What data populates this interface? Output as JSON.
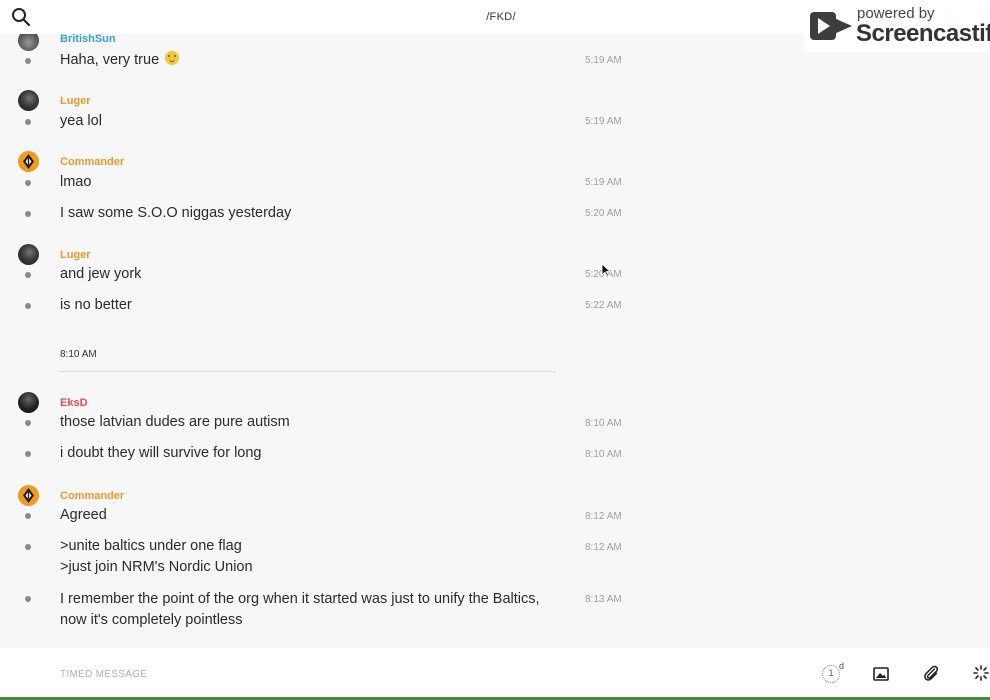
{
  "header": {
    "channel_title": "/FKD/"
  },
  "watermark": {
    "powered_by": "powered by",
    "brand": "Screencastify"
  },
  "messages": [
    {
      "author": "BritishSun",
      "text": "Haha, very true",
      "time": "5:19 AM"
    },
    {
      "author": "Luger",
      "text": "yea lol",
      "time": "5:19 AM"
    },
    {
      "author": "Commander",
      "text": "lmao",
      "time": "5:19 AM"
    },
    {
      "author": "",
      "text": "I saw some S.O.O niggas yesterday",
      "time": "5:20 AM"
    },
    {
      "author": "Luger",
      "text": "and jew york",
      "time": "5:20 AM"
    },
    {
      "author": "",
      "text": "is no better",
      "time": "5:22 AM"
    },
    {
      "author": "EksD",
      "text": "those latvian dudes are pure autism",
      "time": "8:10 AM"
    },
    {
      "author": "",
      "text": "i doubt they will survive for long",
      "time": "8:10 AM"
    },
    {
      "author": "Commander",
      "text": "Agreed",
      "time": "8:12 AM"
    },
    {
      "author": "",
      "text": ">unite baltics under one flag",
      "text2": ">just join NRM's Nordic Union",
      "time": "8:12 AM"
    },
    {
      "author": "",
      "text": "I remember the point of the org when it started was just to unify the Baltics,",
      "text2": "now it's completely pointless",
      "time": "8:13 AM"
    }
  ],
  "divider": {
    "label": "8:10 AM"
  },
  "composer": {
    "placeholder": "TIMED MESSAGE",
    "timer_value": "1",
    "timer_unit": "d"
  },
  "icons": {
    "search": "search-icon",
    "phone": "phone-icon",
    "info": "info-icon",
    "image": "image-icon",
    "attach": "paperclip-icon",
    "more": "sparkle-icon"
  },
  "colors": {
    "author_orange": "#e89a2c",
    "author_red": "#d9534f",
    "author_blue": "#3aa0d8",
    "commander_avatar": "#f29a1c"
  }
}
